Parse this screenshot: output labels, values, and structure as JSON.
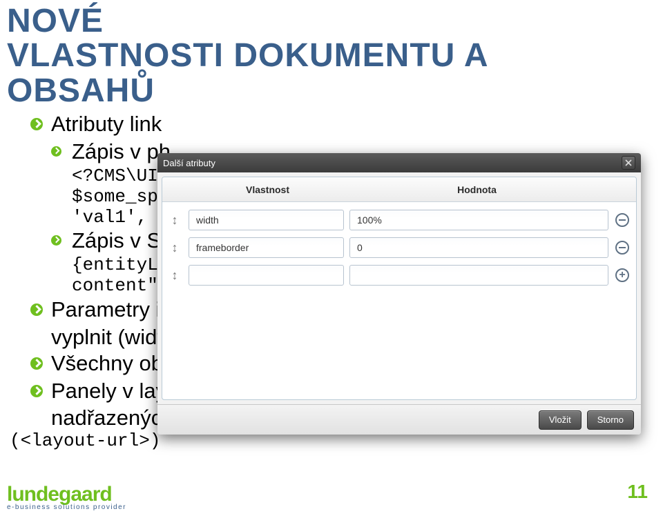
{
  "slide": {
    "title_line1": "NOVÉ",
    "title_line2": "VLASTNOSTI DOKUMENTU A",
    "title_line3": "OBSAHŮ",
    "bullets": [
      {
        "text": "Atributy link",
        "level": 1
      },
      {
        "text": "Zápis v ph",
        "level": 2
      }
    ],
    "code1_l1": "<?CMS\\UI",
    "code1_l2": "$some_sp",
    "code1_l3": "'val1',",
    "code1_greater": ">",
    "bullets2": [
      {
        "text": "Zápis v SM",
        "level": 2
      }
    ],
    "code2_l1": "{entityL",
    "code2_l2": "content\"",
    "bullets3": [
      {
        "text": "Parametry if",
        "level": 1,
        "cont": "vyplnit (widt"
      },
      {
        "text": "Všechny obs",
        "level": 1
      },
      {
        "text": "Panely v layo",
        "level": 1,
        "cont": "nadřazených"
      }
    ],
    "code3": "(<layout-url>)"
  },
  "dialog": {
    "title": "Další atributy",
    "col_key": "Vlastnost",
    "col_val": "Hodnota",
    "rows": [
      {
        "key": "width",
        "val": "100%",
        "ctrl": "remove"
      },
      {
        "key": "frameborder",
        "val": "0",
        "ctrl": "remove"
      },
      {
        "key": "",
        "val": "",
        "ctrl": "add"
      }
    ],
    "btn_submit": "Vložit",
    "btn_cancel": "Storno"
  },
  "footer": {
    "brand": "lundegaard",
    "tag": "e-business solutions provider",
    "pagenum": "11"
  }
}
